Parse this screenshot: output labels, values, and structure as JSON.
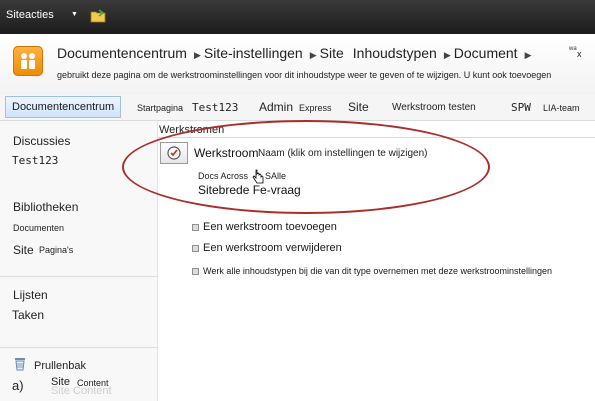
{
  "topbar": {
    "site_actions": "Siteacties"
  },
  "header": {
    "breadcrumb": [
      "Documentencentrum",
      "Site-instellingen",
      "Site",
      "Inhoudstypen",
      "Document"
    ],
    "breadcrumb_tail": "wa",
    "breadcrumb_close": "x",
    "description": "gebruikt deze pagina om de werkstroominstellingen voor dit inhoudstype weer te geven of te wijzigen. U kunt ook toevoegen"
  },
  "nav": {
    "active": "Documentencentrum",
    "items": [
      "Startpagina",
      "Test123",
      "Admin",
      "Express",
      "Site",
      "Werkstroom testen",
      "SPW",
      "LIA-team"
    ]
  },
  "quicklaunch": {
    "discussies": "Discussies",
    "test123": "Test123",
    "bibliotheken": "Bibliotheken",
    "documenten": "Documenten",
    "site": "Site",
    "paginas": "Pagina's",
    "lijsten": "Lijsten",
    "taken": "Taken",
    "prullenbak": "Prullenbak",
    "footer_a": "a)",
    "footer_site": "Site",
    "footer_content": "Content",
    "footer_ghost": "Site Content"
  },
  "main": {
    "title": "Werkstromen",
    "column_header": "Werkstroom",
    "column_name": "Naam (klik om instellingen te wijzigen)",
    "workflow_docs": "Docs Across",
    "workflow_alle": "SAlle",
    "workflow_site": "Sitebrede Fe-vraag",
    "actions": [
      "Een werkstroom toevoegen",
      "Een werkstroom verwijderen",
      "Werk alle inhoudstypen bij die van dit type overnemen met deze werkstroominstellingen"
    ]
  },
  "colors": {
    "accent": "#ff9f1c",
    "nav_active": "#cfe3fb",
    "annotation": "#a8302c",
    "topbar": "#262626"
  },
  "icons": [
    "chevron-down-icon",
    "folder-icon",
    "site-logo-icon",
    "workflow-icon",
    "cursor-icon",
    "bullet-icon",
    "recycle-bin-icon"
  ]
}
